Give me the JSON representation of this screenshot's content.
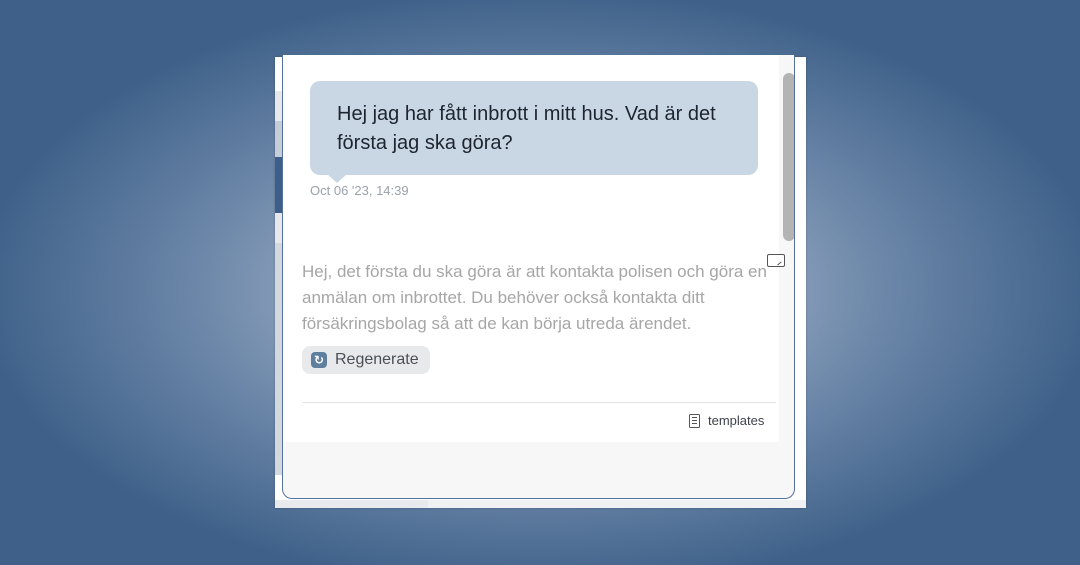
{
  "chat": {
    "user_message": "Hej jag har fått inbrott i mitt hus. Vad är det första jag ska göra?",
    "user_timestamp": "Oct 06 '23, 14:39",
    "assistant_message": "Hej, det första du ska göra är att kontakta polisen och göra en anmälan om inbrottet. Du behöver också kontakta ditt försäkringsbolag så att de kan börja utreda ärendet.",
    "regenerate_label": "Regenerate",
    "regenerate_icon": "refresh-icon",
    "copy_icon": "copy-icon"
  },
  "footer": {
    "templates_label": "templates",
    "templates_icon": "document-icon"
  },
  "colors": {
    "user_bubble": "#c9d6e3",
    "panel_border": "#55729a",
    "background": "#3f6189",
    "regenerate_icon_bg": "#5f7f9f"
  }
}
